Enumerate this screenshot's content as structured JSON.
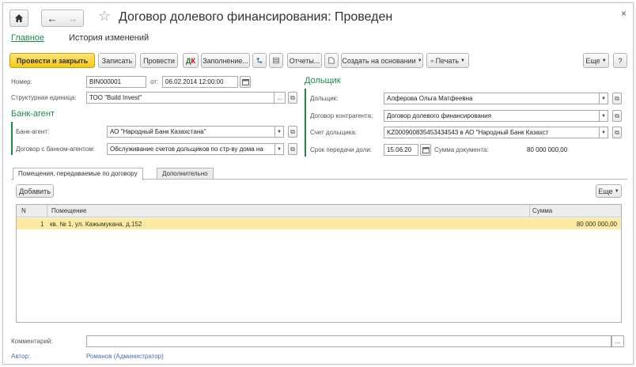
{
  "window": {
    "title": "Договор долевого финансирования: Проведен",
    "close_glyph": "×"
  },
  "nav_tabs": [
    {
      "label": "Главное"
    },
    {
      "label": "История изменений"
    }
  ],
  "toolbar": {
    "post_close": "Провести и закрыть",
    "save": "Записать",
    "post": "Провести",
    "fill": "Заполнение...",
    "reports": "Отчеты...",
    "create_based": "Создать на основании",
    "print": "Печать",
    "more": "Еще",
    "help": "?"
  },
  "header": {
    "number_label": "Номер:",
    "number_value": "BIN000001",
    "date_label": "от:",
    "date_value": "06.02.2014 12:00:00",
    "unit_label": "Структурная единица:",
    "unit_value": "ТОО \"Build Invest\""
  },
  "bank_agent": {
    "section_title": "Банк-агент",
    "bank_label": "Банк-агент:",
    "bank_value": "АО \"Народный Банк Казахстана\"",
    "contract_label": "Договор с банком-агентом:",
    "contract_value": "Обслуживание счетов дольщиков по стр-ву дома на"
  },
  "shareholder": {
    "section_title": "Дольщик",
    "holder_label": "Дольщик:",
    "holder_value": "Алферова Ольга Матфеевна",
    "counterparty_label": "Договор контрагента:",
    "counterparty_value": "Договор долевого финансирования",
    "account_label": "Счет дольщика:",
    "account_value": "KZ000900835453434543 в АО \"Народный Банк Казахст",
    "transfer_label": "Срок передачи доли:",
    "transfer_value": "15.06.20",
    "sum_label": "Сумма документа:",
    "sum_value": "80 000 000,00"
  },
  "form_tabs": [
    {
      "label": "Помещения, передаваемые по договору"
    },
    {
      "label": "Дополнительно"
    }
  ],
  "table": {
    "add_button": "Добавить",
    "more_button": "Еще",
    "columns": [
      "N",
      "Помещение",
      "Сумма"
    ],
    "rows": [
      {
        "n": "1",
        "premises": "кв. № 1, ул. Кажымукана, д.152",
        "sum": "80 000 000,00"
      }
    ]
  },
  "footer": {
    "comment_label": "Комментарий:",
    "comment_value": "",
    "author_label": "Автор:",
    "author_value": "Романов (Администратор)"
  },
  "colors": {
    "accent_green": "#1a8c4a",
    "primary_button": "#f5c914",
    "selected_row": "#fbeaa0",
    "link": "#4a6fb5"
  },
  "icons": [
    "home-icon",
    "back-arrow-icon",
    "forward-arrow-icon",
    "star-icon",
    "close-icon",
    "calendar-icon",
    "dropdown-arrow-icon",
    "open-form-icon"
  ]
}
